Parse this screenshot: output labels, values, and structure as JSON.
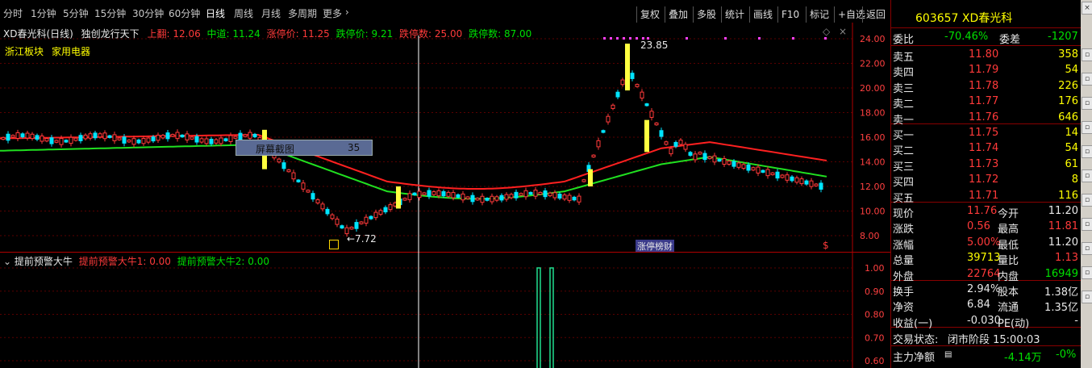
{
  "toolbar": {
    "periods": [
      "分时",
      "1分钟",
      "5分钟",
      "15分钟",
      "30分钟",
      "60分钟",
      "日线",
      "周线",
      "月线",
      "多周期",
      "更多"
    ],
    "active_period": "日线",
    "buttons": [
      "复权",
      "叠加",
      "多股",
      "统计",
      "画线",
      "F10",
      "标记",
      "+自选",
      "返回"
    ]
  },
  "chart": {
    "name": "XD春光科(日线)",
    "indicator": "独创龙行天下",
    "upper_label": "上翻: 12.06",
    "mid_label": "中道: 11.24",
    "zt_price_label": "涨停价: 11.25",
    "dt_price_label": "跌停价: 9.21",
    "dt_count_label": "跌停数: 25.00",
    "zt_count_label": "跌停数: 87.00",
    "sector_label": "浙江板块",
    "industry_label": "家用电器",
    "popup_text": "屏幕截图",
    "popup_num": "35",
    "high_mark": "23.85",
    "low_mark": "←7.72",
    "bottom_tag": "涨停榜",
    "bottom_tag2": "财",
    "dollar": "$",
    "price_axis": [
      "24.00",
      "22.00",
      "20.00",
      "18.00",
      "16.00",
      "14.00",
      "12.00",
      "10.00",
      "8.00"
    ]
  },
  "indicator_panel": {
    "title": "提前预警大牛",
    "line1": "提前预警大牛1: 0.00",
    "line2": "提前预警大牛2: 0.00",
    "axis": [
      "1.00",
      "0.90",
      "0.80",
      "0.70",
      "0.60"
    ]
  },
  "quote": {
    "code_name": "603657 XD春光科",
    "weibi_label": "委比",
    "weibi": "-70.46%",
    "weicha_label": "委差",
    "weicha": "-1207",
    "asks": [
      {
        "label": "卖五",
        "price": "11.80",
        "vol": "358"
      },
      {
        "label": "卖四",
        "price": "11.79",
        "vol": "54"
      },
      {
        "label": "卖三",
        "price": "11.78",
        "vol": "226"
      },
      {
        "label": "卖二",
        "price": "11.77",
        "vol": "176"
      },
      {
        "label": "卖一",
        "price": "11.76",
        "vol": "646"
      }
    ],
    "bids": [
      {
        "label": "买一",
        "price": "11.75",
        "vol": "14"
      },
      {
        "label": "买二",
        "price": "11.74",
        "vol": "54"
      },
      {
        "label": "买三",
        "price": "11.73",
        "vol": "61"
      },
      {
        "label": "买四",
        "price": "11.72",
        "vol": "8"
      },
      {
        "label": "买五",
        "price": "11.71",
        "vol": "116"
      }
    ],
    "stats": [
      {
        "l1": "现价",
        "v1": "11.76",
        "c1": "red",
        "l2": "今开",
        "v2": "11.20",
        "c2": "white"
      },
      {
        "l1": "涨跌",
        "v1": "0.56",
        "c1": "red",
        "l2": "最高",
        "v2": "11.81",
        "c2": "red"
      },
      {
        "l1": "涨幅",
        "v1": "5.00%",
        "c1": "red",
        "l2": "最低",
        "v2": "11.20",
        "c2": "white"
      },
      {
        "l1": "总量",
        "v1": "39713",
        "c1": "yellow",
        "l2": "量比",
        "v2": "1.13",
        "c2": "red"
      },
      {
        "l1": "外盘",
        "v1": "22764",
        "c1": "red",
        "l2": "内盘",
        "v2": "16949",
        "c2": "green"
      }
    ],
    "fund": [
      {
        "l1": "换手",
        "v1": "2.94%",
        "l2": "股本",
        "v2": "1.38亿"
      },
      {
        "l1": "净资",
        "v1": "6.84",
        "l2": "流通",
        "v2": "1.35亿"
      },
      {
        "l1": "收益(一)",
        "v1": "-0.030",
        "l2": "PE(动)",
        "v2": "-"
      }
    ],
    "status_label": "交易状态:",
    "status_value": "闭市阶段 15:00:03",
    "main_flow_label": "主力净额",
    "main_flow_value": "-4.14万",
    "main_flow_pct": "-0%"
  },
  "colors": {
    "up": "#ff3a3a",
    "down": "#00e5ff",
    "red_line": "#ff2020",
    "green_line": "#20e020",
    "accent": "#ffff00"
  }
}
